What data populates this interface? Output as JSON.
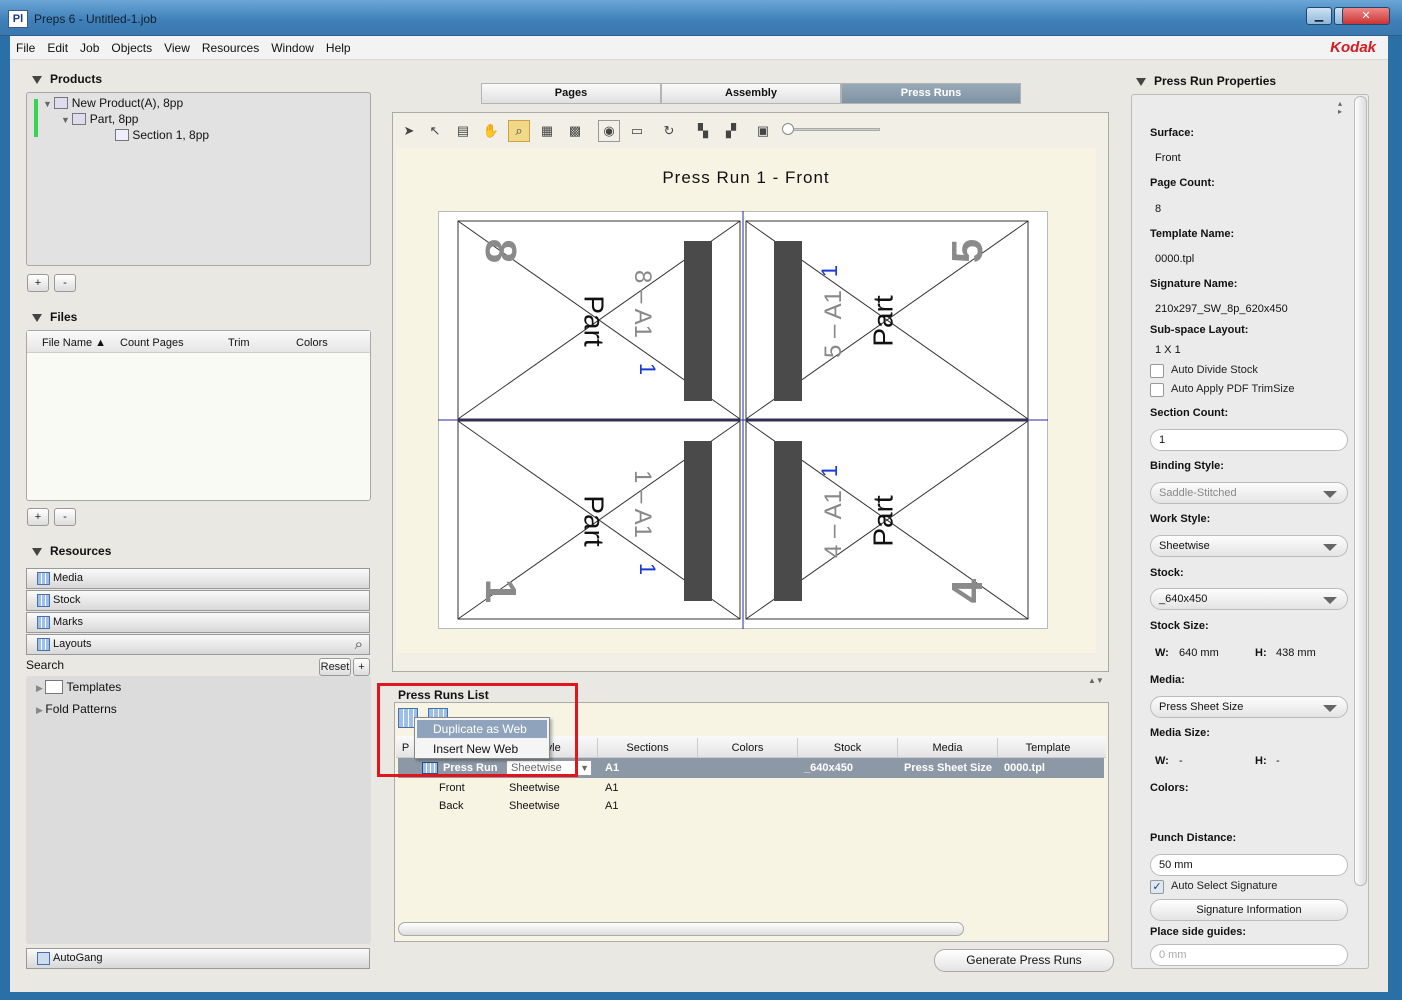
{
  "window": {
    "app_icon": "Pl",
    "title": "Preps 6 - Untitled-1.job",
    "minimize": "▁",
    "maximize": "□",
    "close": "✕"
  },
  "menu": [
    "File",
    "Edit",
    "Job",
    "Objects",
    "View",
    "Resources",
    "Window",
    "Help"
  ],
  "brand": "Kodak",
  "products": {
    "heading": "Products",
    "items": [
      "New Product(A), 8pp",
      "Part, 8pp",
      "Section 1, 8pp"
    ],
    "add": "+",
    "remove": "-"
  },
  "files": {
    "heading": "Files",
    "columns": [
      "File Name ▲",
      "Count Pages",
      "Trim",
      "Colors"
    ],
    "add": "+",
    "remove": "-"
  },
  "resources": {
    "heading": "Resources",
    "bars": [
      "Media",
      "Stock",
      "Marks",
      "Layouts"
    ],
    "search_label": "Search",
    "reset": "Reset",
    "plus": "+",
    "tree": [
      "Templates",
      "Fold Patterns"
    ],
    "autogang": "AutoGang"
  },
  "tabs": [
    "Pages",
    "Assembly",
    "Press Runs"
  ],
  "active_tab": "Press Runs",
  "canvas": {
    "title": "Press Run 1  - Front",
    "pages": [
      {
        "num": "8",
        "label": "Part",
        "code": "8 – A1",
        "vert": "1"
      },
      {
        "num": "5",
        "label": "Part",
        "code": "5 – A1",
        "vert": "1"
      },
      {
        "num": "1",
        "label": "Part",
        "code": "1 – A1",
        "vert": "1"
      },
      {
        "num": "4",
        "label": "Part",
        "code": "4 – A1",
        "vert": "1"
      }
    ]
  },
  "press_runs": {
    "heading": "Press Runs List",
    "context_menu": [
      "Duplicate as Web",
      "Insert New Web"
    ],
    "columns": [
      "P",
      "Style",
      "Sections",
      "Colors",
      "Stock",
      "Media",
      "Template"
    ],
    "selected_row": {
      "name": "Press Run",
      "style": "Sheetwise",
      "sections": "A1",
      "colors": "",
      "stock": "_640x450",
      "media": "Press Sheet Size",
      "template": "0000.tpl"
    },
    "rows": [
      {
        "name": "Front",
        "style": "Sheetwise",
        "sections": "A1"
      },
      {
        "name": "Back",
        "style": "Sheetwise",
        "sections": "A1"
      }
    ],
    "generate": "Generate Press Runs"
  },
  "properties": {
    "heading": "Press Run Properties",
    "surface_label": "Surface:",
    "surface": "Front",
    "page_count_label": "Page Count:",
    "page_count": "8",
    "template_label": "Template Name:",
    "template": "0000.tpl",
    "signature_label": "Signature Name:",
    "signature": "210x297_SW_8p_620x450",
    "subspace_label": "Sub-space Layout:",
    "subspace": "1 X 1",
    "auto_divide": "Auto Divide Stock",
    "auto_apply": "Auto Apply PDF TrimSize",
    "section_count_label": "Section Count:",
    "section_count": "1",
    "binding_label": "Binding Style:",
    "binding": "Saddle-Stitched",
    "work_label": "Work Style:",
    "work": "Sheetwise",
    "stock_label": "Stock:",
    "stock": "_640x450",
    "stock_size_label": "Stock Size:",
    "stock_w_label": "W:",
    "stock_w": "640 mm",
    "stock_h_label": "H:",
    "stock_h": "438 mm",
    "media_label": "Media:",
    "media": "Press Sheet Size",
    "media_size_label": "Media Size:",
    "media_w_label": "W:",
    "media_w": "-",
    "media_h_label": "H:",
    "media_h": "-",
    "colors_label": "Colors:",
    "punch_label": "Punch Distance:",
    "punch": "50 mm",
    "auto_select": "Auto Select Signature",
    "sig_info": "Signature Information",
    "side_guides_label": "Place side guides:",
    "side_guides": "0 mm"
  }
}
